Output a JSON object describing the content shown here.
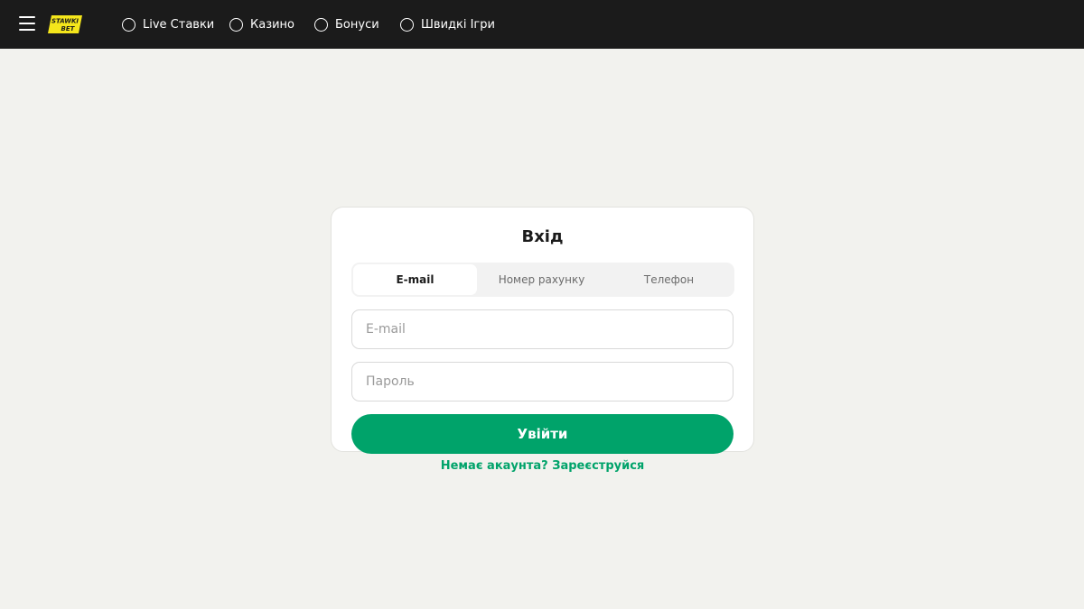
{
  "header": {
    "menu_icon": "hamburger-icon",
    "logo_text_top": "STAWKI",
    "logo_text_bottom": "BET",
    "logo_color": "#f5e61b",
    "nav": [
      {
        "label": "Live Ставки",
        "icon": "circle-icon"
      },
      {
        "label": "Казино",
        "icon": "circle-icon"
      },
      {
        "label": "Бонуси",
        "icon": "circle-icon"
      },
      {
        "label": "Швидкі Ігри",
        "icon": "circle-icon"
      }
    ]
  },
  "login": {
    "title": "Вхід",
    "tabs": [
      {
        "label": "E-mail",
        "active": true
      },
      {
        "label": "Номер рахунку",
        "active": false
      },
      {
        "label": "Телефон",
        "active": false
      }
    ],
    "email_placeholder": "E-mail",
    "email_value": "",
    "password_placeholder": "Пароль",
    "password_value": "",
    "submit_label": "Увійти",
    "register_text": "Немає акаунта? Зареєструйся"
  },
  "colors": {
    "accent": "#00a36a",
    "header_bg": "#1b1b1b",
    "page_bg": "#f2f2ee"
  }
}
